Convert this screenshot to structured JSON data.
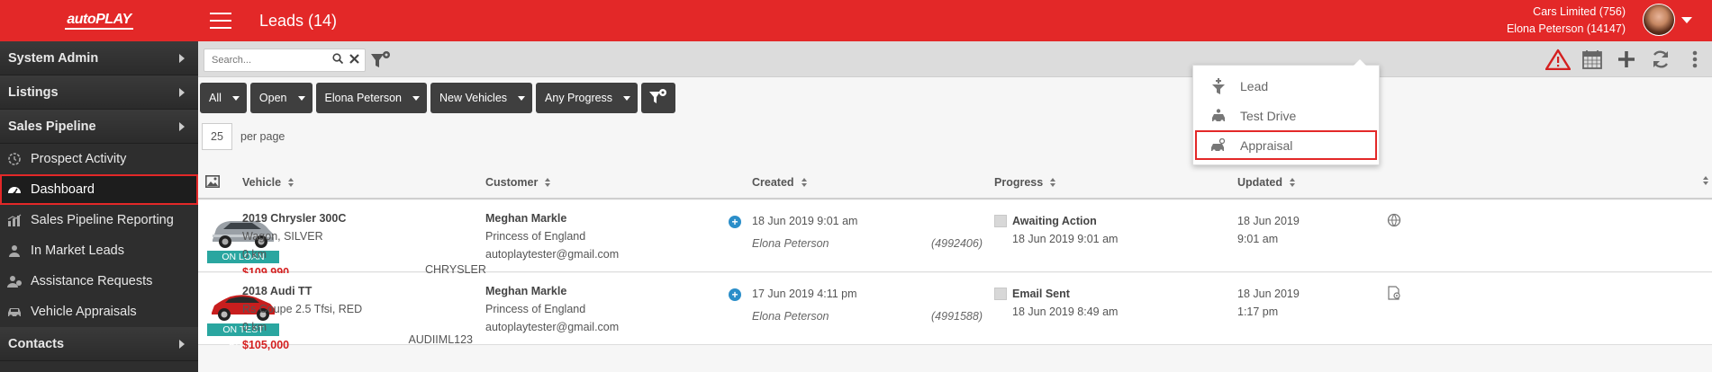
{
  "header": {
    "logo_text": "autoPLAY",
    "title": "Leads (14)",
    "account_company": "Cars Limited (756)",
    "account_user": "Elona Peterson (14147)"
  },
  "sidebar": {
    "sections": [
      {
        "label": "System Admin"
      },
      {
        "label": "Listings"
      },
      {
        "label": "Sales Pipeline"
      }
    ],
    "items": [
      {
        "label": "Prospect Activity",
        "icon": "gear-clock-icon"
      },
      {
        "label": "Dashboard",
        "icon": "gauge-icon",
        "active": true
      },
      {
        "label": "Sales Pipeline Reporting",
        "icon": "bar-chart-icon"
      },
      {
        "label": "In Market Leads",
        "icon": "person-icon"
      },
      {
        "label": "Assistance Requests",
        "icon": "person-help-icon"
      },
      {
        "label": "Vehicle Appraisals",
        "icon": "car-icon"
      }
    ],
    "bottom_section": {
      "label": "Contacts"
    }
  },
  "toolbar": {
    "search_placeholder": "Search..."
  },
  "filters": [
    {
      "label": "All"
    },
    {
      "label": "Open"
    },
    {
      "label": "Elona Peterson"
    },
    {
      "label": "New Vehicles"
    },
    {
      "label": "Any Progress"
    }
  ],
  "pagination": {
    "per_page_value": "25",
    "per_page_label": "per page"
  },
  "table": {
    "columns": [
      "Vehicle",
      "Customer",
      "Created",
      "Progress",
      "Updated"
    ],
    "rows": [
      {
        "badge": "ON LOAN",
        "vehicle_title": "2019 Chrysler 300C",
        "vehicle_desc": "Wagon, SILVER",
        "vehicle_km": "0 km",
        "vehicle_price": "$109,990",
        "vehicle_code": "CHRYSLER",
        "customer_name": "Meghan Markle",
        "customer_title": "Princess of England",
        "customer_email": "autoplaytester@gmail.com",
        "created": "18 Jun 2019 9:01 am",
        "created_by": "Elona Peterson",
        "lead_id": "(4992406)",
        "progress_status": "Awaiting Action",
        "progress_date": "18 Jun 2019 9:01 am",
        "updated_date": "18 Jun 2019",
        "updated_time": "9:01 am",
        "car_color": "#9aa0a6"
      },
      {
        "badge": "ON TEST DRIVE",
        "vehicle_title": "2018 Audi TT",
        "vehicle_desc": "Rs Coupe 2.5 Tfsi, RED",
        "vehicle_km": "0 km",
        "vehicle_price": "$105,000",
        "vehicle_code": "AUDIIML123",
        "customer_name": "Meghan Markle",
        "customer_title": "Princess of England",
        "customer_email": "autoplaytester@gmail.com",
        "created": "17 Jun 2019 4:11 pm",
        "created_by": "Elona Peterson",
        "lead_id": "(4991588)",
        "progress_status": "Email Sent",
        "progress_date": "18 Jun 2019 8:49 am",
        "updated_date": "18 Jun 2019",
        "updated_time": "1:17 pm",
        "car_color": "#c81e1e"
      }
    ]
  },
  "add_menu": {
    "items": [
      {
        "label": "Lead",
        "icon": "funnel-plus-icon"
      },
      {
        "label": "Test Drive",
        "icon": "car-driver-icon"
      },
      {
        "label": "Appraisal",
        "icon": "car-appraisal-icon",
        "highlighted": true
      }
    ]
  },
  "colors": {
    "brand_red": "#e32828",
    "sidebar_bg": "#2e2e2e",
    "badge_teal": "#2aa6a0",
    "price_red": "#d42020",
    "add_blue": "#2b8ec9"
  }
}
